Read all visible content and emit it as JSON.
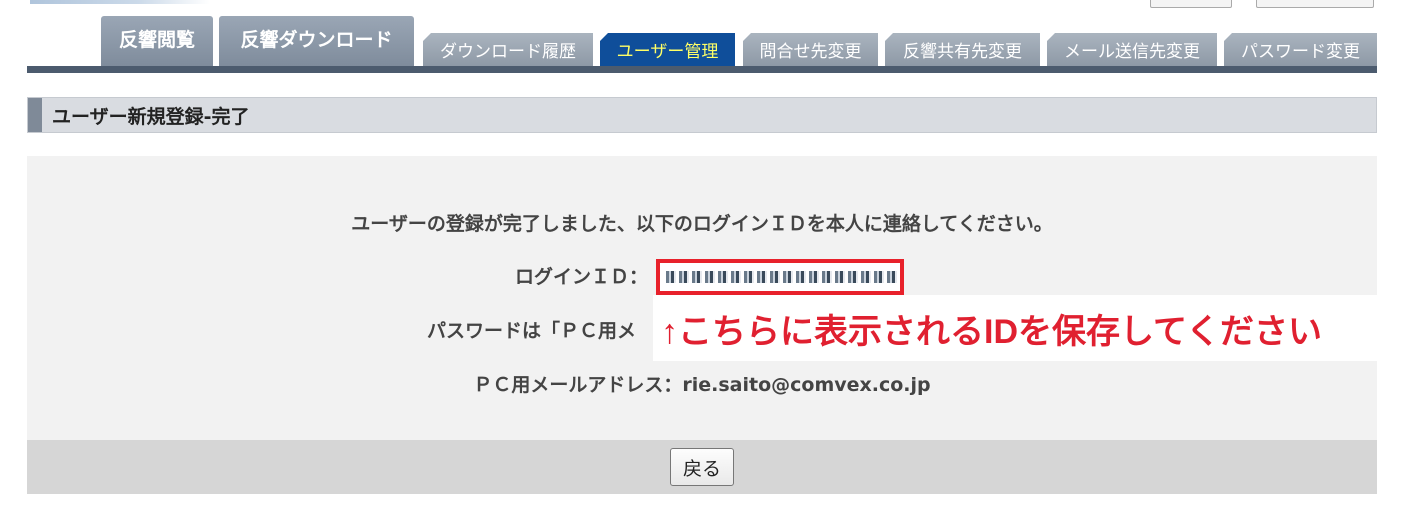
{
  "tabs": [
    {
      "label": "反響閲覧"
    },
    {
      "label": "反響ダウンロード"
    },
    {
      "label": "ダウンロード履歴"
    },
    {
      "label": "ユーザー管理"
    },
    {
      "label": "問合せ先変更"
    },
    {
      "label": "反響共有先変更"
    },
    {
      "label": "メール送信先変更"
    },
    {
      "label": "パスワード変更"
    }
  ],
  "section": {
    "title": "ユーザー新規登録-完了"
  },
  "message": {
    "complete": "ユーザーの登録が完了しました、以下のログインＩＤを本人に連絡してください。",
    "login_id_label": "ログインＩＤ：",
    "password_prefix": "パスワードは「ＰＣ用メ",
    "email_line": "ＰＣ用メールアドレス：rie.saito@comvex.co.jp"
  },
  "annotation": {
    "text": "↑こちらに表示されるIDを保存してください",
    "color": "#e02030"
  },
  "footer": {
    "back_label": "戻る"
  },
  "colors": {
    "active_tab": "#0f4e9a",
    "active_tab_text": "#ffff66",
    "tab_line": "#4c5b6e",
    "highlight_border": "#e8212b"
  }
}
